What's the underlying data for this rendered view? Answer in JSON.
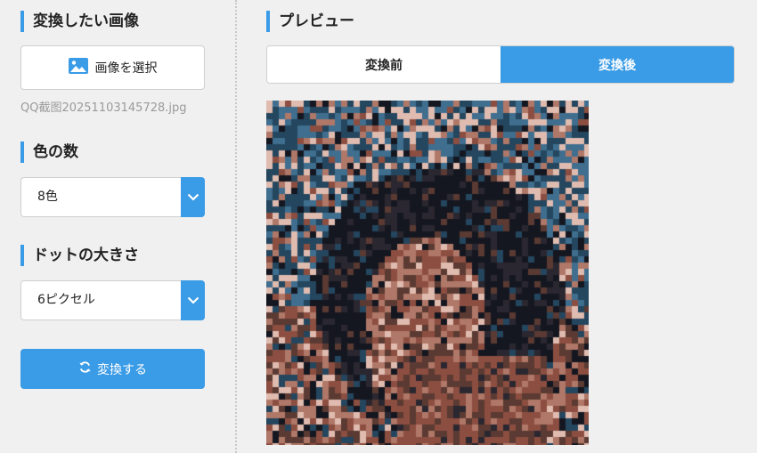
{
  "left": {
    "image_section_title": "変換したい画像",
    "select_image_label": "画像を選択",
    "filename": "QQ截图20251103145728.jpg",
    "colors_section_title": "色の数",
    "colors_value": "8色",
    "dot_section_title": "ドットの大きさ",
    "dot_value": "6ピクセル",
    "convert_label": "変換する"
  },
  "right": {
    "preview_title": "プレビュー",
    "tabs": [
      {
        "label": "変換前",
        "active": false
      },
      {
        "label": "変換後",
        "active": true
      }
    ]
  },
  "colors": {
    "accent": "#3a9be6",
    "palette": [
      "#151720",
      "#2a2730",
      "#24465e",
      "#3f6e8f",
      "#5a3a32",
      "#8c4e40",
      "#b07868",
      "#e0bcb0"
    ]
  },
  "icons": {
    "image": "image-icon",
    "chevron": "chevron-down-icon",
    "refresh": "refresh-icon"
  }
}
